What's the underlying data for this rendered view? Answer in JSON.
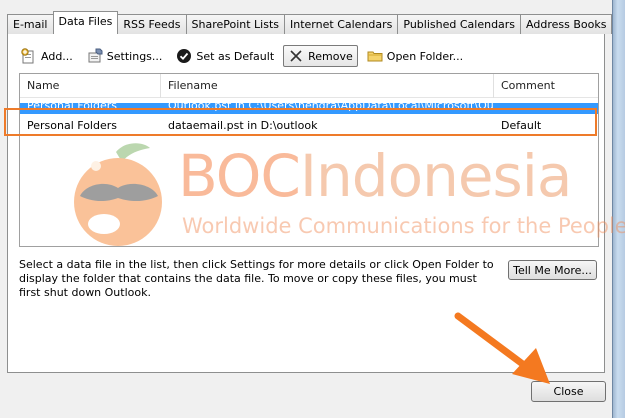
{
  "tabs": [
    {
      "label": "E-mail",
      "active": false
    },
    {
      "label": "Data Files",
      "active": true
    },
    {
      "label": "RSS Feeds",
      "active": false
    },
    {
      "label": "SharePoint Lists",
      "active": false
    },
    {
      "label": "Internet Calendars",
      "active": false
    },
    {
      "label": "Published Calendars",
      "active": false
    },
    {
      "label": "Address Books",
      "active": false
    }
  ],
  "toolbar": {
    "add_label": "Add...",
    "settings_label": "Settings...",
    "set_default_label": "Set as Default",
    "remove_label": "Remove",
    "open_folder_label": "Open Folder..."
  },
  "list": {
    "columns": {
      "name": "Name",
      "filename": "Filename",
      "comment": "Comment"
    },
    "rows": [
      {
        "name": "Personal Folders",
        "filename": "Outlook.pst in C:\\Users\\hendra\\AppData\\Local\\Microsoft\\Outlook",
        "comment": "",
        "selected": true
      },
      {
        "name": "Personal Folders",
        "filename": "dataemail.pst in D:\\outlook",
        "comment": "Default",
        "selected": false
      }
    ]
  },
  "watermark": {
    "brand_boc": "BOC",
    "brand_indonesia": "Indonesia",
    "tagline": "Worldwide Communications for the People"
  },
  "description": "Select a data file in the list, then click Settings for more details or click Open Folder to display the folder that contains the data file. To move or copy these files, you must first shut down Outlook.",
  "tell_me_more_label": "Tell Me More...",
  "close_label": "Close",
  "colors": {
    "selection": "#3399ff",
    "highlight_box": "#ee7b2a",
    "arrow": "#f47920"
  }
}
